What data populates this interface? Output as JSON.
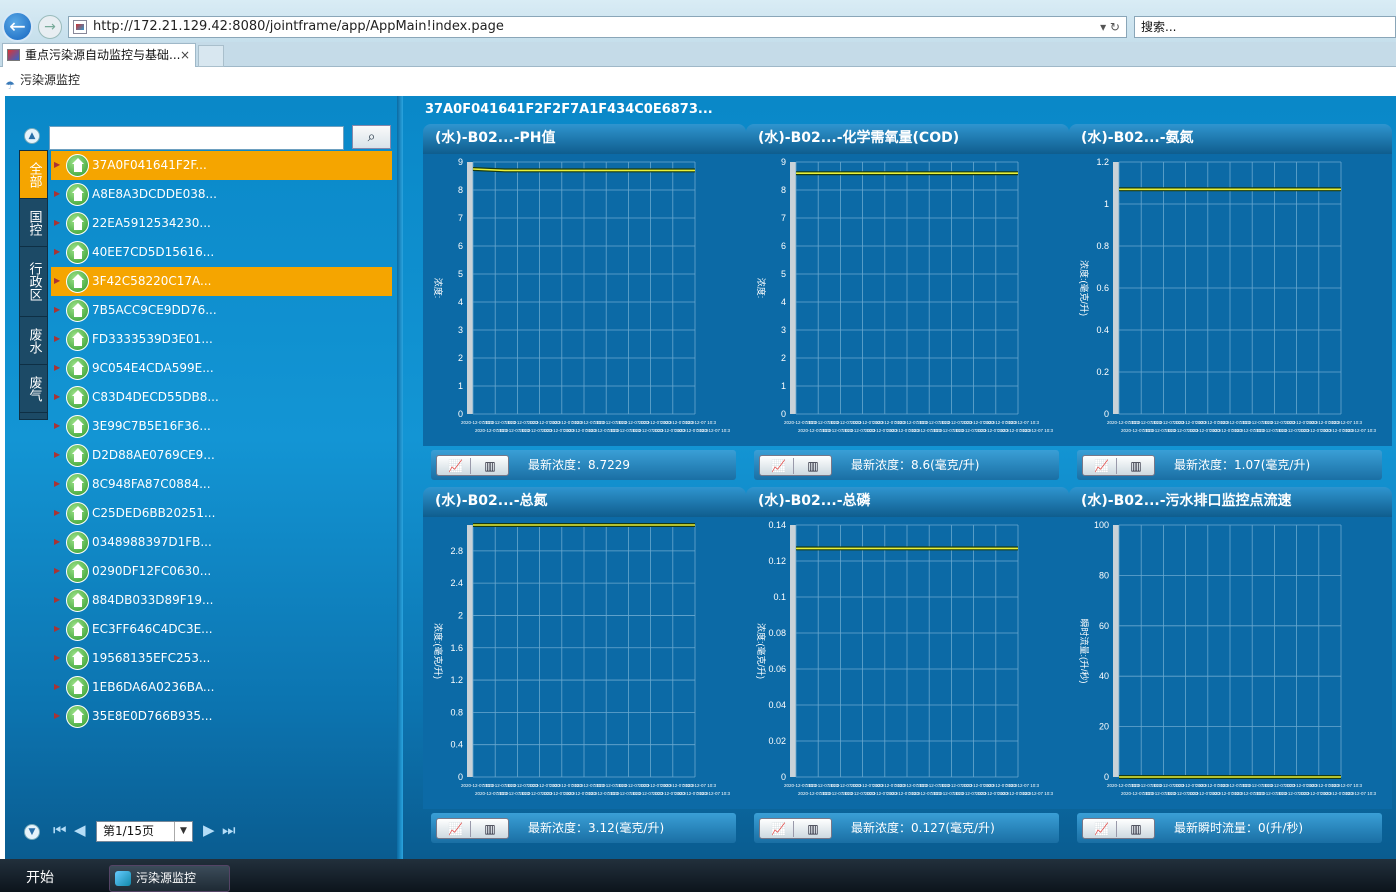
{
  "browser": {
    "url": "http://172.21.129.42:8080/jointframe/app/AppMain!index.page",
    "search_placeholder": "搜索...",
    "tab_title": "重点污染源自动监控与基础...",
    "tab_close": "×",
    "refresh": "▾ ↻"
  },
  "app": {
    "title": "污染源监控",
    "selected_station": "37A0F041641F2F2F7A1F434C0E6873..."
  },
  "category_tabs": [
    "全部",
    "国控",
    "行政区",
    "废水",
    "废气"
  ],
  "tree_items": [
    "37A0F041641F2F...",
    "A8E8A3DCDDE038...",
    "22EA5912534230...",
    "40EE7CD5D15616...",
    "3F42C58220C17A...",
    "7B5ACC9CE9DD76...",
    "FD3333539D3E01...",
    "9C054E4CDA599E...",
    "C83D4DECD55DB8...",
    "3E99C7B5E16F36...",
    "D2D88AE0769CE9...",
    "8C948FA87C0884...",
    "C25DED6BB20251...",
    "0348988397D1FB...",
    "0290DF12FC0630...",
    "884DB033D89F19...",
    "EC3FF646C4DC3E...",
    "19568135EFC253...",
    "1EB6DA6A0236BA...",
    "35E8E0D766B935..."
  ],
  "pager": {
    "label": "第1/15页"
  },
  "panels": [
    {
      "title": "(水)-B02...-PH值",
      "ylabel": "浓度:",
      "footer": "最新浓度：8.7229",
      "chart_data": {
        "type": "line",
        "ylim": [
          0,
          9
        ],
        "yticks": [
          "0",
          "1",
          "2",
          "3",
          "4",
          "5",
          "6",
          "7",
          "8",
          "9"
        ],
        "values": [
          8.75,
          8.7,
          8.7,
          8.7,
          8.7,
          8.7,
          8.7,
          8.7
        ]
      }
    },
    {
      "title": "(水)-B02...-化学需氧量(COD)",
      "ylabel": "浓度:",
      "footer": "最新浓度：8.6(毫克/升)",
      "chart_data": {
        "type": "line",
        "ylim": [
          0,
          9
        ],
        "yticks": [
          "0",
          "1",
          "2",
          "3",
          "4",
          "5",
          "6",
          "7",
          "8",
          "9"
        ],
        "values": [
          8.6,
          8.6,
          8.6,
          8.6,
          8.6,
          8.6,
          8.6,
          8.6
        ]
      }
    },
    {
      "title": "(水)-B02...-氨氮",
      "ylabel": "浓度:(毫克/升)",
      "footer": "最新浓度：1.07(毫克/升)",
      "chart_data": {
        "type": "line",
        "ylim": [
          0,
          1.2
        ],
        "yticks": [
          "0",
          "0.2",
          "0.4",
          "0.6",
          "0.8",
          "1",
          "1.2"
        ],
        "values": [
          1.07,
          1.07,
          1.07,
          1.07,
          1.07,
          1.07,
          1.07,
          1.07
        ]
      }
    },
    {
      "title": "(水)-B02...-总氮",
      "ylabel": "浓度:(毫克/升)",
      "footer": "最新浓度：3.12(毫克/升)",
      "chart_data": {
        "type": "line",
        "ylim": [
          0,
          3.12
        ],
        "yticks": [
          "0",
          "0.4",
          "0.8",
          "1.2",
          "1.6",
          "2",
          "2.4",
          "2.8"
        ],
        "values": [
          3.12,
          3.12,
          3.12,
          3.12,
          3.12,
          3.12,
          3.12,
          3.12
        ]
      }
    },
    {
      "title": "(水)-B02...-总磷",
      "ylabel": "浓度:(毫克/升)",
      "footer": "最新浓度：0.127(毫克/升)",
      "chart_data": {
        "type": "line",
        "ylim": [
          0,
          0.14
        ],
        "yticks": [
          "0",
          "0.02",
          "0.04",
          "0.06",
          "0.08",
          "0.1",
          "0.12",
          "0.14"
        ],
        "values": [
          0.127,
          0.127,
          0.127,
          0.127,
          0.127,
          0.127,
          0.127,
          0.127
        ]
      }
    },
    {
      "title": "(水)-B02...-污水排口监控点流速",
      "ylabel": "瞬时流量:(升/秒)",
      "footer": "最新瞬时流量：0(升/秒)",
      "chart_data": {
        "type": "line",
        "ylim": [
          0,
          100
        ],
        "yticks": [
          "0",
          "20",
          "40",
          "60",
          "80",
          "100"
        ],
        "values": [
          0,
          0,
          0,
          0,
          0,
          0,
          0,
          0
        ]
      }
    }
  ],
  "xtick_text": "2020-12-07 10:3",
  "taskbar": {
    "start": "开始",
    "task": "污染源监控"
  }
}
